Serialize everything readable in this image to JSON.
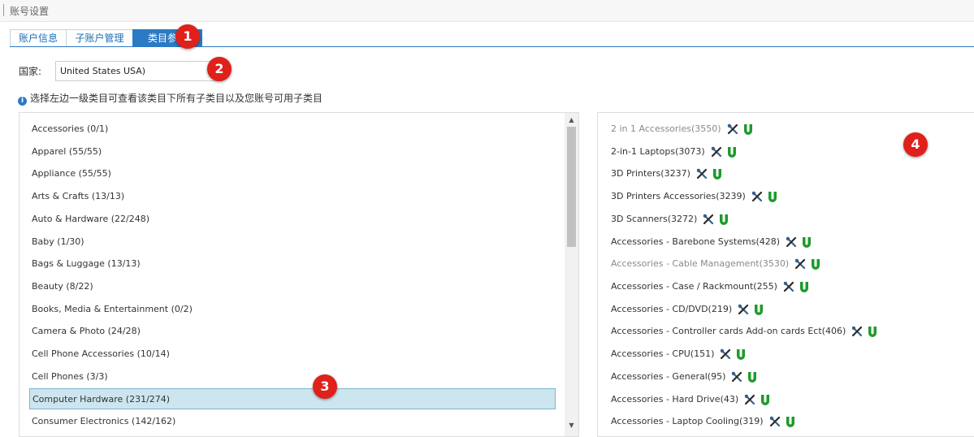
{
  "header": {
    "title": "账号设置"
  },
  "tabs": [
    {
      "label": "账户信息",
      "active": false
    },
    {
      "label": "子账户管理",
      "active": false
    },
    {
      "label": "类目参考",
      "active": true
    }
  ],
  "country": {
    "label": "国家:",
    "value": "United States USA)"
  },
  "hint": {
    "text": "选择左边一级类目可查看该类目下所有子类目以及您账号可用子类目"
  },
  "categories": [
    {
      "label": "Accessories (0/1)"
    },
    {
      "label": "Apparel (55/55)"
    },
    {
      "label": "Appliance (55/55)"
    },
    {
      "label": "Arts & Crafts (13/13)"
    },
    {
      "label": "Auto & Hardware (22/248)"
    },
    {
      "label": "Baby (1/30)"
    },
    {
      "label": "Bags & Luggage (13/13)"
    },
    {
      "label": "Beauty (8/22)"
    },
    {
      "label": "Books, Media & Entertainment (0/2)"
    },
    {
      "label": "Camera & Photo (24/28)"
    },
    {
      "label": "Cell Phone Accessories (10/14)"
    },
    {
      "label": "Cell Phones (3/3)"
    },
    {
      "label": "Computer Hardware (231/274)",
      "selected": true
    },
    {
      "label": "Consumer Electronics (142/162)"
    }
  ],
  "subcategories": [
    {
      "label": "2 in 1 Accessories(3550)",
      "muted": true
    },
    {
      "label": "2-in-1 Laptops(3073)"
    },
    {
      "label": "3D Printers(3237)"
    },
    {
      "label": "3D Printers Accessories(3239)"
    },
    {
      "label": "3D Scanners(3272)"
    },
    {
      "label": "Accessories - Barebone Systems(428)"
    },
    {
      "label": "Accessories - Cable Management(3530)",
      "muted": true
    },
    {
      "label": "Accessories - Case / Rackmount(255)"
    },
    {
      "label": "Accessories - CD/DVD(219)"
    },
    {
      "label": "Accessories - Controller cards Add-on cards Ect(406)"
    },
    {
      "label": "Accessories - CPU(151)"
    },
    {
      "label": "Accessories - General(95)"
    },
    {
      "label": "Accessories - Hard Drive(43)"
    },
    {
      "label": "Accessories - Laptop Cooling(319)"
    }
  ],
  "badges": [
    "1",
    "2",
    "3",
    "4"
  ],
  "colors": {
    "accent": "#2b7ac5",
    "selected_bg": "#cde5ef",
    "badge": "#e0201a",
    "u_icon": "#1e9a2c"
  }
}
